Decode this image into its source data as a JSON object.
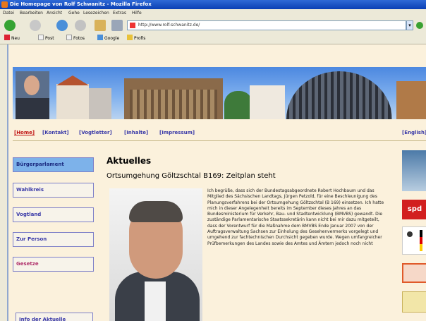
{
  "window": {
    "title": "Die Homepage von Rolf Schwanitz - Mozilla Firefox"
  },
  "menu": [
    "Datei",
    "Bearbeiten",
    "Ansicht",
    "Gehe",
    "Lesezeichen",
    "Extras",
    "Hilfe"
  ],
  "url": "http://www.rolf-schwanitz.de/",
  "bookmarks": [
    "Neu",
    "Post",
    "Fotos",
    "Google",
    "Profis"
  ],
  "site": {
    "nav": [
      {
        "label": "[Home]"
      },
      {
        "label": "[Kontakt]"
      },
      {
        "label": "[Vogtletter]"
      },
      {
        "label": "[Inhalte]"
      },
      {
        "label": "[Impressum]"
      },
      {
        "label": "[English]"
      }
    ],
    "sidebar": [
      {
        "label": "Bürgerparlament"
      },
      {
        "label": "Wahlkreis"
      },
      {
        "label": "Vogtland"
      },
      {
        "label": "Zur Person"
      },
      {
        "label": "Gesetze"
      }
    ],
    "bottom_button": "Info der Aktuelle",
    "content": {
      "title": "Aktuelles",
      "subtitle": "Ortsumgehung Göltzschtal B169: Zeitplan steht",
      "article": "Ich begrüße, dass sich der Bundestagsabgeordnete Robert Hochbaum und das Mitglied des Sächsischen Landtags, Jürgen Petzold, für eine Beschleunigung des Planungsverfahrens bei der Ortsumgehung Göltzschtal (B 169) einsetzen. Ich hatte mich in dieser Angelegenheit bereits im September dieses Jahres an das Bundesministerium für Verkehr, Bau- und Stadtentwicklung (BMVBS) gewandt. Die zuständige Parlamentarische Staatssekretärin kann nicht bei mir dazu mitgeteilt, dass der Vorentwurf für die Maßnahme dem BMVBS Ende Januar 2007 von der Auftragsverwaltung Sachsen zur Einholung des Gesehenvermerks vorgelegt und umgehend zur fachtechnischen Durchsicht gegeben wurde. Wegen umfangreicher Prüfbemerkungen des Landes sowie des Amtes und Ämtern jedoch noch nicht"
    },
    "right_logo": "spd"
  }
}
